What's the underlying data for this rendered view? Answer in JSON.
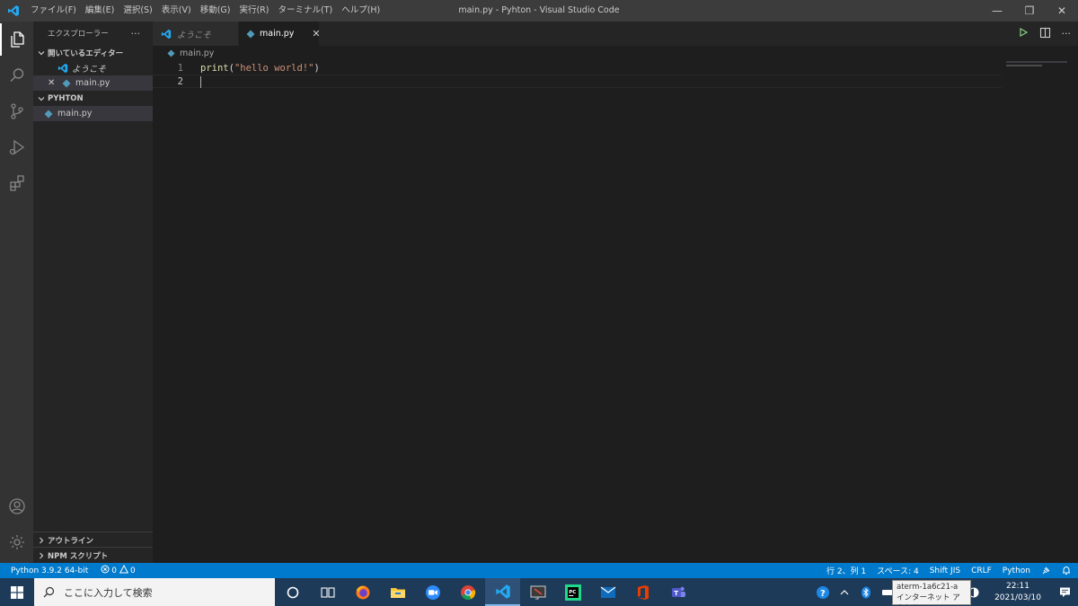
{
  "titlebar": {
    "menu": [
      "ファイル(F)",
      "編集(E)",
      "選択(S)",
      "表示(V)",
      "移動(G)",
      "実行(R)",
      "ターミナル(T)",
      "ヘルプ(H)"
    ],
    "title": "main.py - Pyhton - Visual Studio Code",
    "minimize": "—",
    "restore": "❐",
    "close": "✕"
  },
  "sidebar": {
    "title": "エクスプローラー",
    "more": "···",
    "open_editors": {
      "label": "開いているエディター",
      "items": [
        {
          "name": "ようこそ"
        },
        {
          "name": "main.py",
          "close": "✕"
        }
      ]
    },
    "folder": {
      "label": "PYHTON",
      "items": [
        {
          "name": "main.py"
        }
      ]
    },
    "outline": "アウトライン",
    "npm": "NPM スクリプト"
  },
  "tabs": [
    {
      "label": "ようこそ"
    },
    {
      "label": "main.py",
      "close": "✕"
    }
  ],
  "breadcrumb": "main.py",
  "editor": {
    "lines": [
      {
        "num": "1",
        "fn": "print",
        "open": "(",
        "str": "\"hello world!\"",
        "close": ")"
      },
      {
        "num": "2"
      }
    ]
  },
  "statusbar": {
    "interpreter": "Python 3.9.2 64-bit",
    "errors": "0",
    "warnings": "0",
    "position": "行 2、列 1",
    "spaces": "スペース: 4",
    "encoding": "Shift JIS",
    "eol": "CRLF",
    "language": "Python"
  },
  "taskbar": {
    "search_placeholder": "ここに入力して検索",
    "time": "22:11",
    "date": "2021/03/10",
    "tooltip_line1": "aterm-1a6c21-a",
    "tooltip_line2": "インターネット アクセス"
  },
  "colors": {
    "accent": "#007acc",
    "python_icon": "#519aba",
    "vscode_blue": "#23a9f2"
  }
}
